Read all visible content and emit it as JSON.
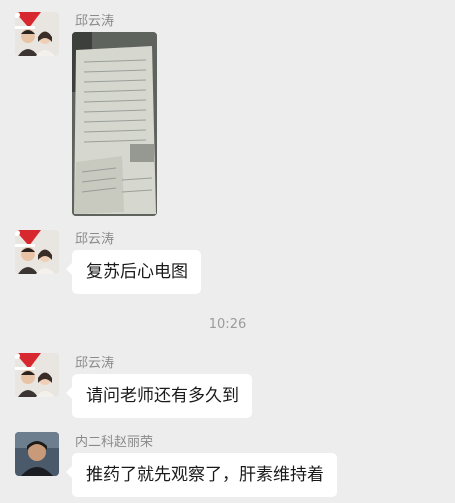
{
  "messages": [
    {
      "sender": "邱云涛",
      "type": "image",
      "avatar_icon": "user-couple-santa-hat-icon",
      "image_icon": "ecg-paper-photo-icon"
    },
    {
      "sender": "邱云涛",
      "type": "text",
      "text": "复苏后心电图",
      "avatar_icon": "user-couple-santa-hat-icon"
    },
    {
      "timestamp": "10:26"
    },
    {
      "sender": "邱云涛",
      "type": "text",
      "text": "请问老师还有多久到",
      "avatar_icon": "user-couple-santa-hat-icon"
    },
    {
      "sender": "内二科赵丽荣",
      "type": "text",
      "text": "推药了就先观察了，肝素维持着",
      "avatar_icon": "user-portrait-icon"
    }
  ],
  "colors": {
    "background": "#ededed",
    "bubble": "#ffffff",
    "sender_name": "#8a8a8a",
    "timestamp": "#9b9b9b"
  }
}
